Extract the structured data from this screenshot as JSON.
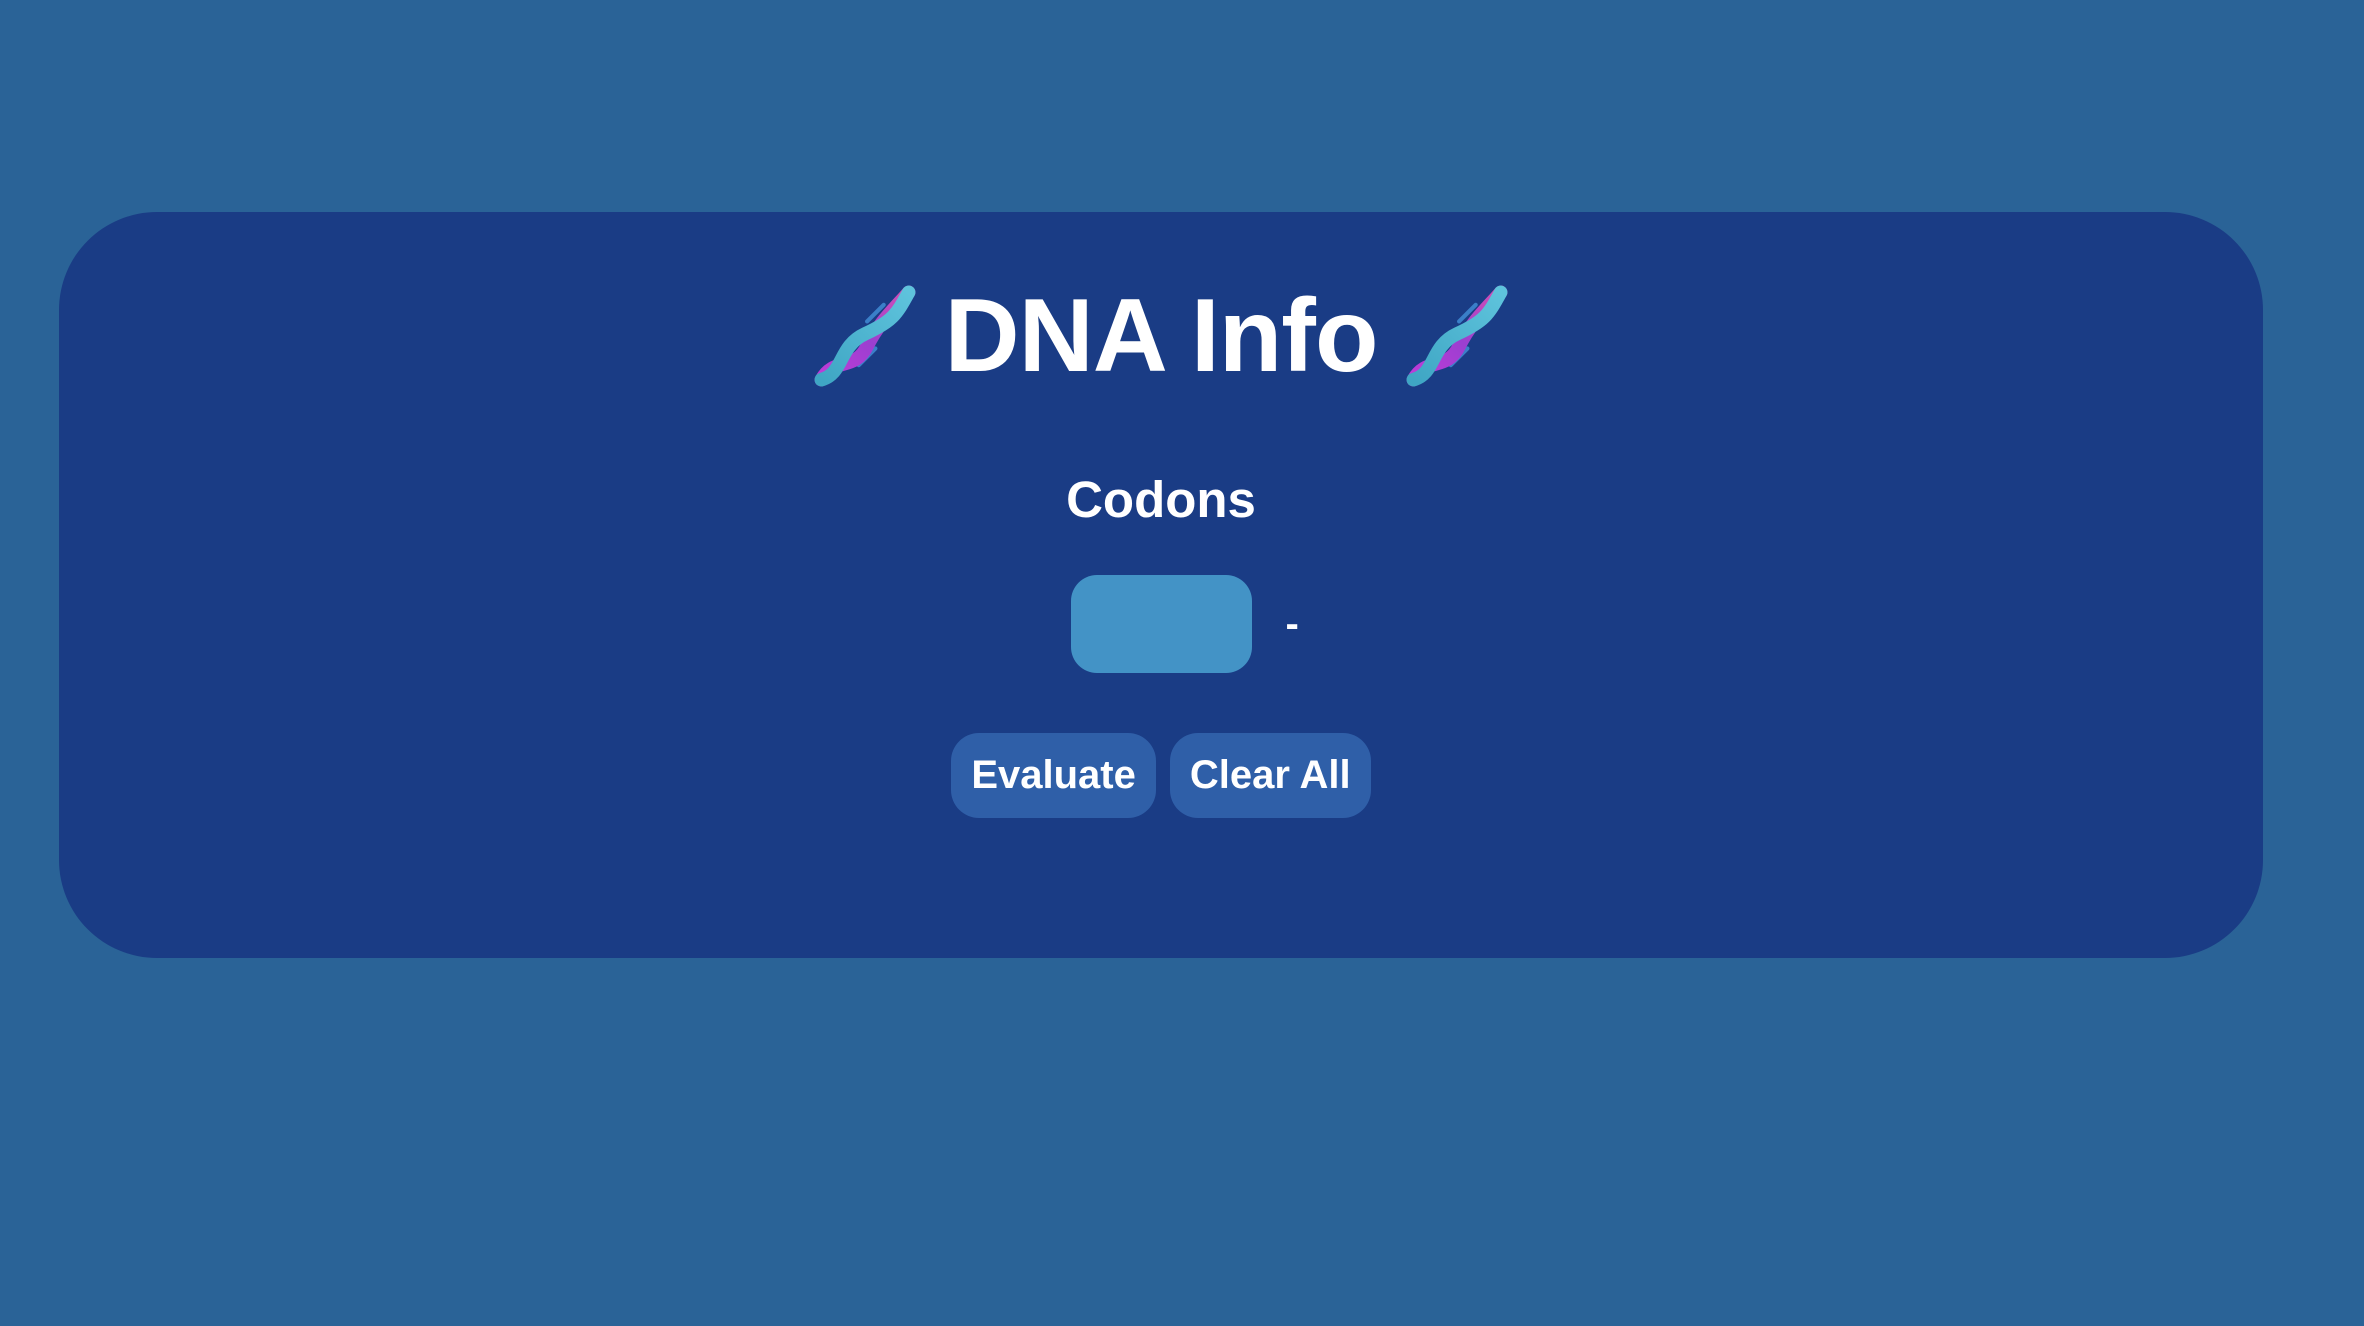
{
  "header": {
    "title": "DNA Info",
    "icon_left": "dna-icon",
    "icon_right": "dna-icon"
  },
  "codons": {
    "heading": "Codons",
    "input_value": "",
    "result": "-"
  },
  "actions": {
    "evaluate_label": "Evaluate",
    "clear_label": "Clear All"
  },
  "colors": {
    "page_background": "#2a6397",
    "card_background": "#1a3c85",
    "input_background": "#4393c6",
    "button_background": "#2f5fa8",
    "text": "#ffffff"
  }
}
